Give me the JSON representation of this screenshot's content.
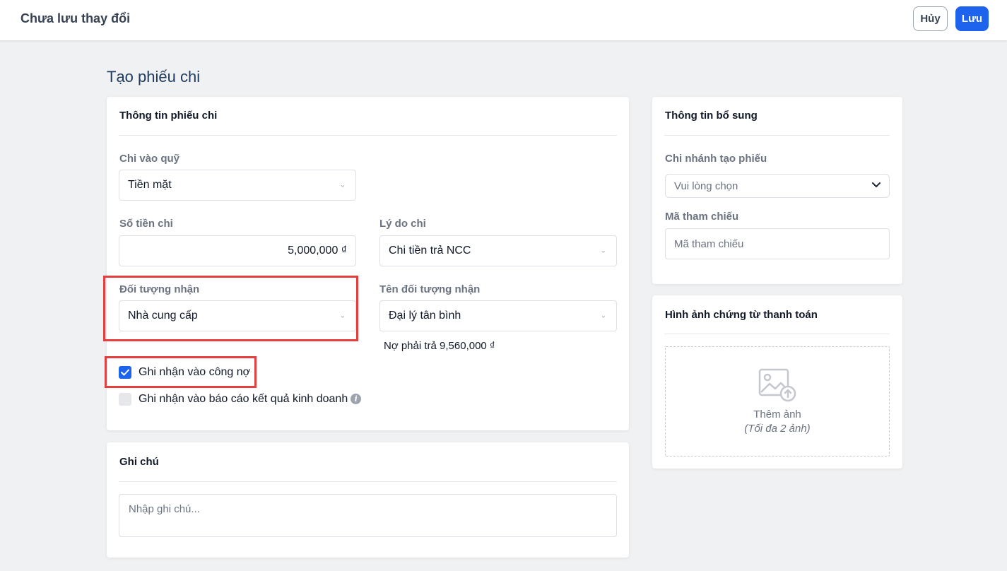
{
  "topbar": {
    "status": "Chưa lưu thay đổi",
    "cancel_label": "Hủy",
    "save_label": "Lưu"
  },
  "page": {
    "title": "Tạo phiếu chi"
  },
  "voucher_info": {
    "title": "Thông tin phiếu chi",
    "fund": {
      "label": "Chi vào quỹ",
      "value": "Tiền mặt"
    },
    "amount": {
      "label": "Số tiền chi",
      "value": "5,000,000 ₫"
    },
    "reason": {
      "label": "Lý do chi",
      "value": "Chi tiền trả NCC"
    },
    "recipient_type": {
      "label": "Đối tượng nhận",
      "value": "Nhà cung cấp"
    },
    "recipient_name": {
      "label": "Tên đối tượng nhận",
      "value": "Đại lý tân bình"
    },
    "debt_note": "Nợ phải trả 9,560,000 ₫",
    "record_debt": {
      "label": "Ghi nhận vào công nợ",
      "checked": true
    },
    "record_report": {
      "label": "Ghi nhận vào báo cáo kết quả kinh doanh",
      "checked": false
    }
  },
  "notes": {
    "title": "Ghi chú",
    "placeholder": "Nhập ghi chú..."
  },
  "extra_info": {
    "title": "Thông tin bổ sung",
    "branch": {
      "label": "Chi nhánh tạo phiếu",
      "placeholder": "Vui lòng chọn"
    },
    "reference": {
      "label": "Mã tham chiếu",
      "placeholder": "Mã tham chiếu"
    }
  },
  "images": {
    "title": "Hình ảnh chứng từ thanh toán",
    "add_label": "Thêm ảnh",
    "limit_note": "(Tối đa 2 ảnh)"
  },
  "colors": {
    "primary": "#1d63ed",
    "highlight": "#e53e3e",
    "background": "#f0f1f3"
  }
}
